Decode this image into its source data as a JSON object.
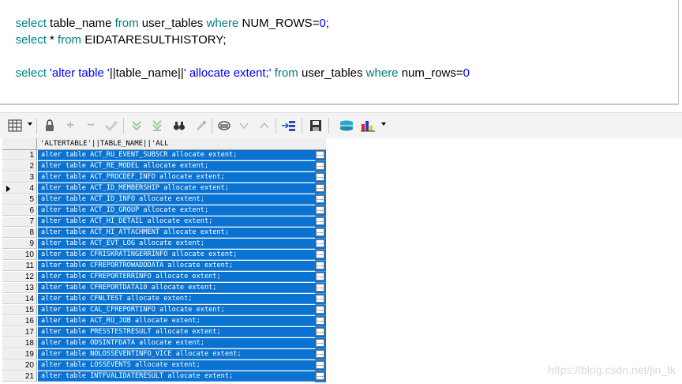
{
  "editor": {
    "line1": [
      "select",
      " table_name ",
      "from",
      " user_tables ",
      "where",
      " NUM_ROWS",
      "=",
      "0",
      ";"
    ],
    "line2": [
      "select",
      " * ",
      "from",
      " EIDATARESULTHISTORY;"
    ],
    "line3": [
      "select",
      " ",
      "'alter table '",
      "||",
      "table_name",
      "||",
      "' allocate extent;'",
      " ",
      "from",
      " user_tables ",
      "where",
      " num_rows",
      "=",
      "0"
    ]
  },
  "grid": {
    "column_header": "'ALTERTABLE'||TABLE_NAME||'ALL",
    "current_row": 4,
    "rows": [
      {
        "n": "1",
        "v": "alter table ACT_RU_EVENT_SUBSCR allocate extent;"
      },
      {
        "n": "2",
        "v": "alter table ACT_RE_MODEL allocate extent;"
      },
      {
        "n": "3",
        "v": "alter table ACT_PROCDEF_INFO allocate extent;"
      },
      {
        "n": "4",
        "v": "alter table ACT_ID_MEMBERSHIP allocate extent;"
      },
      {
        "n": "5",
        "v": "alter table ACT_ID_INFO allocate extent;"
      },
      {
        "n": "6",
        "v": "alter table ACT_ID_GROUP allocate extent;"
      },
      {
        "n": "7",
        "v": "alter table ACT_HI_DETAIL allocate extent;"
      },
      {
        "n": "8",
        "v": "alter table ACT_HI_ATTACHMENT allocate extent;"
      },
      {
        "n": "9",
        "v": "alter table ACT_EVT_LOG allocate extent;"
      },
      {
        "n": "10",
        "v": "alter table CFRISKRATINGERRINFO allocate extent;"
      },
      {
        "n": "11",
        "v": "alter table CFREPORTROWADDDATA allocate extent;"
      },
      {
        "n": "12",
        "v": "alter table CFREPORTERRINFO allocate extent;"
      },
      {
        "n": "13",
        "v": "alter table CFREPORTDATA10 allocate extent;"
      },
      {
        "n": "14",
        "v": "alter table CFNLTEST allocate extent;"
      },
      {
        "n": "15",
        "v": "alter table CAL_CFREPORTINFO allocate extent;"
      },
      {
        "n": "16",
        "v": "alter table ACT_RU_JOB allocate extent;"
      },
      {
        "n": "17",
        "v": "alter table PRESSTESTRESULT allocate extent;"
      },
      {
        "n": "18",
        "v": "alter table ODSINTFDATA allocate extent;"
      },
      {
        "n": "19",
        "v": "alter table NOLOSSEVENTINFO_VICE allocate extent;"
      },
      {
        "n": "20",
        "v": "alter table LOSSEVENTS allocate extent;"
      },
      {
        "n": "21",
        "v": "alter table INTFVALIDATERESULT allocate extent;"
      }
    ]
  },
  "watermark": "https://blog.csdn.net/jin_tk",
  "colors": {
    "selection": "#0a73d2",
    "keyword": "#008080",
    "string": "#0000ff"
  }
}
